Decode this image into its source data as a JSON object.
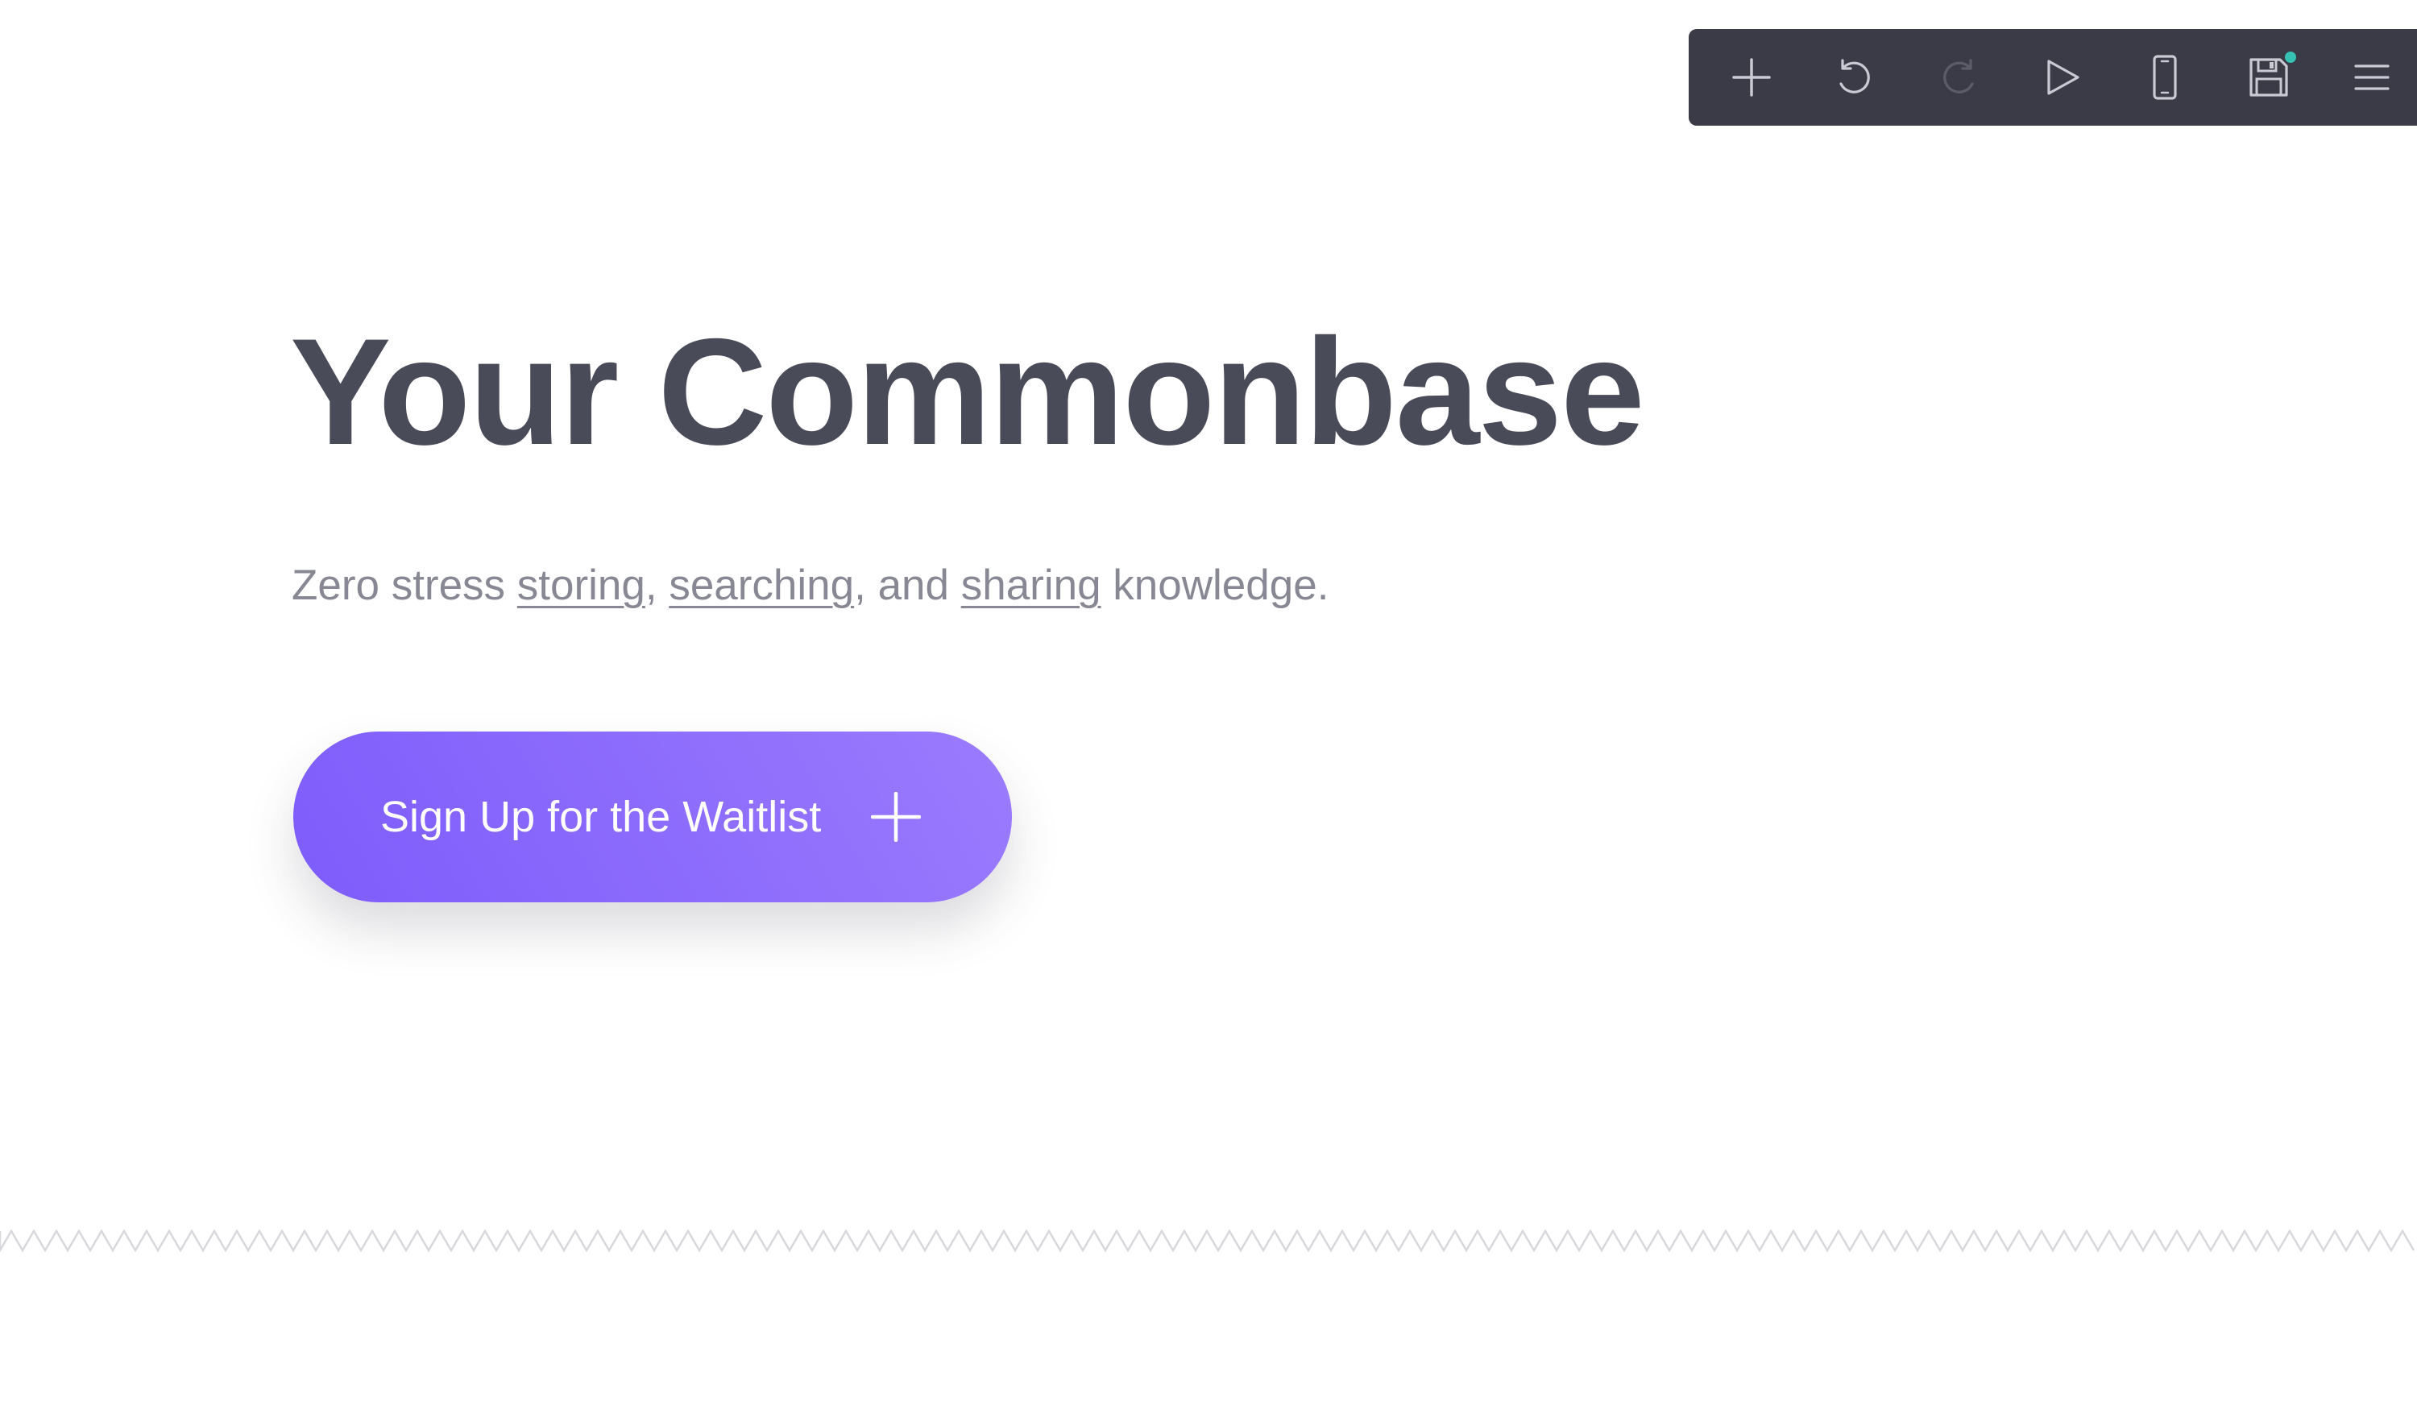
{
  "toolbar": {
    "tools": [
      {
        "name": "add",
        "icon": "plus-icon"
      },
      {
        "name": "undo",
        "icon": "undo-icon"
      },
      {
        "name": "redo",
        "icon": "redo-icon",
        "disabled": true
      },
      {
        "name": "preview",
        "icon": "play-icon"
      },
      {
        "name": "mobile-view",
        "icon": "smartphone-icon"
      },
      {
        "name": "save",
        "icon": "save-icon",
        "has_unsaved_indicator": true
      },
      {
        "name": "menu",
        "icon": "menu-icon"
      }
    ],
    "colors": {
      "background": "#3a3b46",
      "icon": "#c9cad3",
      "icon_disabled": "#5c5d69",
      "indicator": "#35c2b3"
    }
  },
  "hero": {
    "title": "Your Commonbase",
    "subtitle_parts": {
      "prefix": "Zero stress ",
      "link1": "storing",
      "sep1": ", ",
      "link2": "searching",
      "sep2": ", and ",
      "link3": "sharing",
      "suffix": " knowledge."
    },
    "cta_label": "Sign Up for the Waitlist",
    "cta_icon": "plus-icon"
  },
  "colors": {
    "title": "#4a4b58",
    "subtitle": "#878893",
    "cta_gradient_start": "#7d5cfb",
    "cta_gradient_end": "#9b7bfd",
    "divider": "#d8d8dc"
  }
}
